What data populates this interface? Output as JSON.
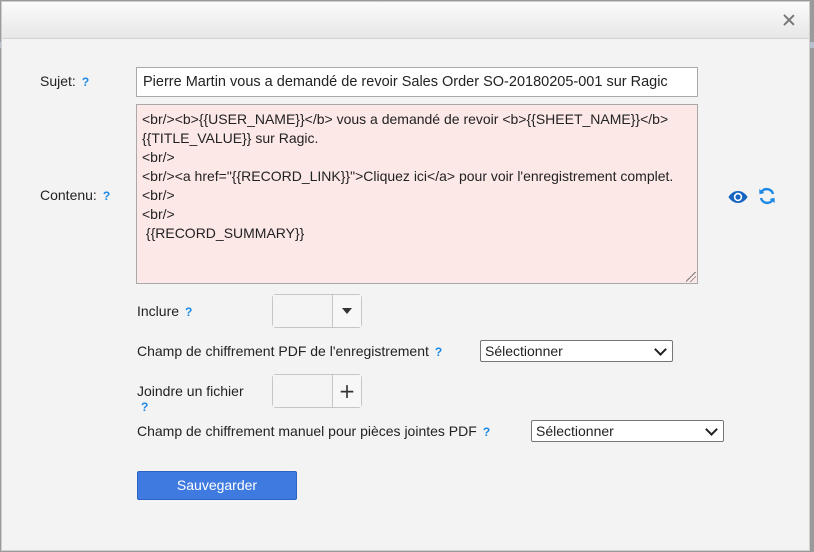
{
  "dialog": {
    "subject_label": "Sujet:",
    "subject_value": "Pierre Martin vous a demandé de revoir Sales Order SO-20180205-001 sur Ragic",
    "content_label": "Contenu:",
    "content_value": "<br/><b>{{USER_NAME}}</b> vous a demandé de revoir <b>{{SHEET_NAME}}</b> {{TITLE_VALUE}} sur Ragic.\n<br/>\n<br/><a href=\"{{RECORD_LINK}}\">Cliquez ici</a> pour voir l'enregistrement complet.\n<br/>\n<br/>\n {{RECORD_SUMMARY}}",
    "include_label": "Inclure",
    "pdf_encrypt_label": "Champ de chiffrement PDF de l'enregistrement",
    "pdf_encrypt_select": "Sélectionner",
    "attach_label": "Joindre un fichier",
    "manual_encrypt_label": "Champ de chiffrement manuel pour pièces jointes PDF",
    "manual_encrypt_select": "Sélectionner",
    "save_button": "Sauvegarder",
    "help_glyph": "?"
  },
  "colors": {
    "accent": "#3f7ae0",
    "help": "#1e88e5",
    "content_bg": "#fde8e8",
    "dialog_bg": "#f3f3f3"
  },
  "icons": [
    "close-icon",
    "help-icon",
    "eye-icon",
    "refresh-icon",
    "dropdown-arrow-icon",
    "plus-icon",
    "select-chevron-icon"
  ]
}
